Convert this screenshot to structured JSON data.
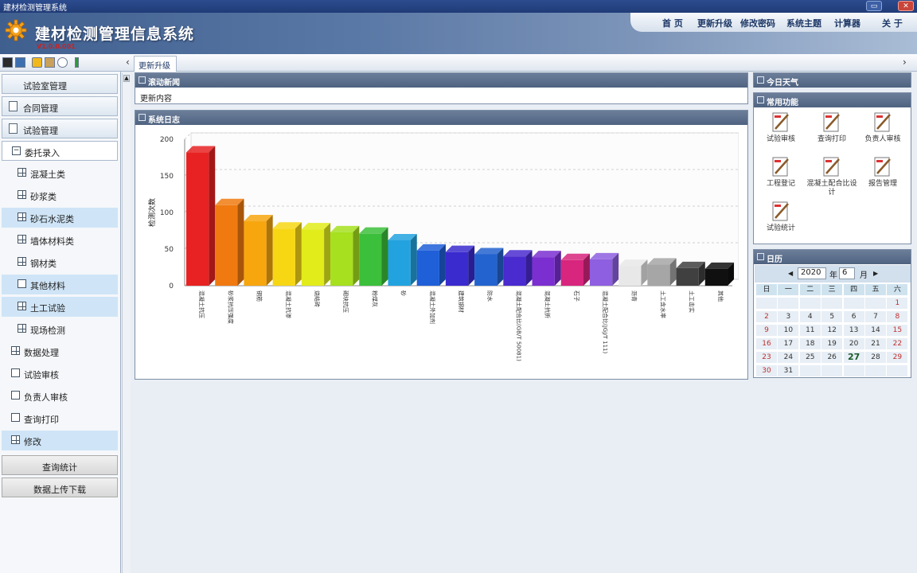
{
  "window": {
    "title": "建材检测管理系统",
    "min_label": "▭",
    "close_label": "✕"
  },
  "header": {
    "title": "建材检测管理信息系统",
    "subtitle": "V1.0.0.001",
    "nav": [
      "首 页",
      "更新升级",
      "修改密码",
      "系统主题",
      "计算器",
      "关 于"
    ]
  },
  "tabs": {
    "active": "更新升级",
    "prev": "‹",
    "next": "›"
  },
  "sidebar": {
    "sections": [
      "试验室管理",
      "合同管理",
      "试验管理"
    ],
    "items": [
      {
        "label": "委托录入"
      },
      {
        "label": "混凝土类"
      },
      {
        "label": "砂浆类"
      },
      {
        "label": "砂石水泥类"
      },
      {
        "label": "墙体材料类"
      },
      {
        "label": "钢材类"
      },
      {
        "label": "其他材料"
      },
      {
        "label": "土工试验"
      },
      {
        "label": "现场检测"
      },
      {
        "label": "数据处理"
      },
      {
        "label": "试验审核"
      },
      {
        "label": "负责人审核"
      },
      {
        "label": "查询打印"
      },
      {
        "label": "修改"
      }
    ],
    "bottom": [
      "查询统计",
      "数据上传下载"
    ]
  },
  "notice": {
    "title": "滚动新闻",
    "text": "更新内容"
  },
  "chart_panel": {
    "title": "系统日志"
  },
  "weather": {
    "title": "今日天气"
  },
  "functions": {
    "title": "常用功能",
    "items": [
      "试验审核",
      "查询打印",
      "负责人审核",
      "工程登记",
      "混凝土配合比设计",
      "报告管理",
      "试验统计"
    ]
  },
  "calendar": {
    "title": "日历",
    "year": "2020",
    "year_label": "年",
    "month": "6",
    "month_label": "月",
    "prev": "◀",
    "next": "▶",
    "weekdays": [
      "日",
      "一",
      "二",
      "三",
      "四",
      "五",
      "六"
    ],
    "days": [
      "1",
      "2",
      "3",
      "4",
      "5",
      "6",
      "7",
      "8",
      "9",
      "10",
      "11",
      "12",
      "13",
      "14",
      "15",
      "16",
      "17",
      "18",
      "19",
      "20",
      "21",
      "22",
      "23",
      "24",
      "25",
      "26",
      "27",
      "28",
      "29",
      "30",
      "31"
    ],
    "today": "27"
  },
  "chart_data": {
    "type": "bar",
    "ylabel": "检测次数",
    "ylim": [
      0,
      200
    ],
    "yticks": [
      0,
      50,
      100,
      150,
      200
    ],
    "grid": true,
    "categories": [
      "混凝土抗压",
      "砂浆抗压强度",
      "钢筋",
      "混凝土抗渗",
      "烧结砖",
      "砌块抗压",
      "粉煤灰",
      "砂",
      "混凝土外加剂",
      "建筑钢材",
      "防水",
      "混凝土配合比(GB/T 50081)",
      "混凝土抗折",
      "石子",
      "混凝土配合比(JGJ/T 111)",
      "沥青",
      "土工含水率",
      "土工击实",
      "其他"
    ],
    "values": [
      182,
      110,
      88,
      78,
      77,
      73,
      71,
      62,
      48,
      46,
      43,
      40,
      39,
      35,
      36,
      27,
      29,
      24,
      23
    ],
    "colors": [
      "#e82222",
      "#f07a10",
      "#f7a60e",
      "#f7d714",
      "#e2ec1a",
      "#a6e01e",
      "#3cbf3a",
      "#22a3df",
      "#1f5fd8",
      "#3a2bcf",
      "#2363cf",
      "#4a2bcf",
      "#7b2fd0",
      "#d8257e",
      "#8e5fe0",
      "#e8e8e8",
      "#a6a6a6",
      "#404040",
      "#101010"
    ]
  }
}
